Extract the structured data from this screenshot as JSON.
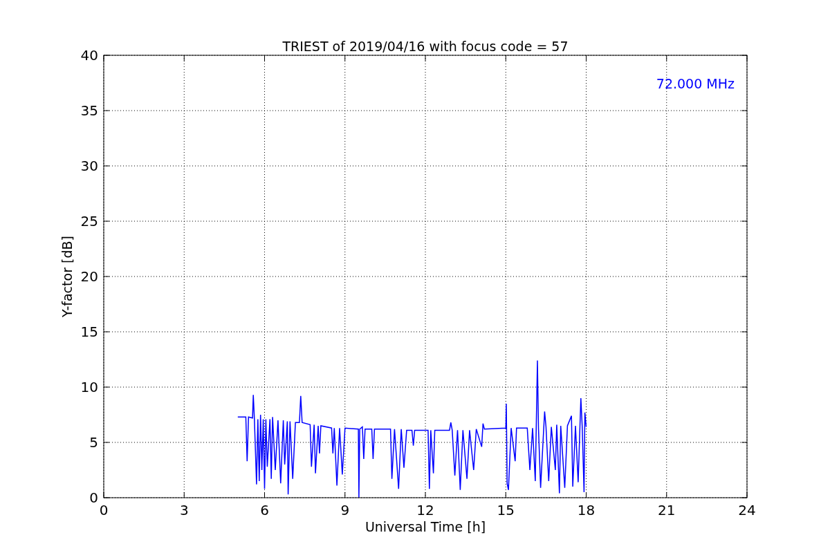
{
  "figure": {
    "chart_data": {
      "type": "line",
      "title": "TRIEST of 2019/04/16 with focus code = 57",
      "xlabel": "Universal Time [h]",
      "ylabel": "Y-factor [dB]",
      "x": [
        5.0,
        5.3,
        5.35,
        5.4,
        5.55,
        5.58,
        5.62,
        5.7,
        5.75,
        5.8,
        5.85,
        5.9,
        5.95,
        6.0,
        6.05,
        6.1,
        6.2,
        6.25,
        6.3,
        6.4,
        6.5,
        6.6,
        6.7,
        6.75,
        6.85,
        6.88,
        6.95,
        7.05,
        7.15,
        7.3,
        7.35,
        7.4,
        7.7,
        7.75,
        7.85,
        7.9,
        8.0,
        8.05,
        8.1,
        8.5,
        8.55,
        8.6,
        8.7,
        8.8,
        8.9,
        9.0,
        9.5,
        9.52,
        9.55,
        9.65,
        9.7,
        9.75,
        10.0,
        10.05,
        10.1,
        10.7,
        10.75,
        10.85,
        11.0,
        11.1,
        11.2,
        11.3,
        11.5,
        11.55,
        11.6,
        12.1,
        12.15,
        12.2,
        12.3,
        12.35,
        12.9,
        12.95,
        13.0,
        13.1,
        13.2,
        13.3,
        13.4,
        13.55,
        13.65,
        13.8,
        13.9,
        14.1,
        14.15,
        14.2,
        15.0,
        15.02,
        15.05,
        15.1,
        15.2,
        15.35,
        15.4,
        15.8,
        15.9,
        16.0,
        16.1,
        16.18,
        16.22,
        16.3,
        16.45,
        16.5,
        16.6,
        16.7,
        16.85,
        16.9,
        17.0,
        17.05,
        17.2,
        17.3,
        17.45,
        17.5,
        17.6,
        17.7,
        17.8,
        17.85,
        17.92,
        17.95,
        18.0
      ],
      "series": [
        {
          "name": "72.000 MHz",
          "color": "#0000ff",
          "values": [
            7.3,
            7.3,
            3.3,
            7.3,
            7.2,
            9.3,
            7.1,
            1.2,
            7.1,
            1.5,
            7.5,
            2.5,
            7.1,
            0.8,
            7.1,
            2.8,
            7.1,
            1.7,
            7.3,
            2.5,
            7.0,
            1.3,
            7.0,
            3.0,
            6.9,
            0.3,
            6.9,
            1.7,
            6.8,
            6.8,
            9.2,
            6.8,
            6.6,
            2.8,
            6.6,
            2.2,
            6.5,
            4.0,
            6.5,
            6.3,
            4.0,
            6.3,
            1.1,
            6.3,
            2.1,
            6.3,
            6.2,
            0.0,
            6.2,
            6.4,
            3.5,
            6.2,
            6.2,
            3.5,
            6.2,
            6.2,
            1.7,
            6.2,
            0.8,
            6.2,
            2.7,
            6.1,
            6.1,
            4.7,
            6.1,
            6.1,
            0.8,
            6.1,
            2.2,
            6.1,
            6.1,
            6.8,
            6.1,
            2.0,
            6.1,
            0.7,
            6.1,
            1.7,
            6.1,
            2.5,
            6.2,
            4.6,
            6.7,
            6.2,
            6.3,
            8.5,
            1.3,
            0.7,
            6.3,
            3.3,
            6.3,
            6.3,
            2.5,
            6.3,
            1.5,
            12.4,
            6.3,
            0.9,
            7.8,
            6.4,
            1.5,
            6.4,
            2.5,
            6.6,
            0.4,
            6.5,
            0.9,
            6.5,
            7.4,
            1.0,
            6.5,
            1.4,
            9.0,
            6.5,
            0.5,
            7.7,
            6.4
          ]
        }
      ],
      "xlim": [
        0,
        24
      ],
      "ylim": [
        0,
        40
      ],
      "xticks": [
        0,
        3,
        6,
        9,
        12,
        15,
        18,
        21,
        24
      ],
      "yticks": [
        0,
        5,
        10,
        15,
        20,
        25,
        30,
        35,
        40
      ],
      "grid": true
    }
  }
}
